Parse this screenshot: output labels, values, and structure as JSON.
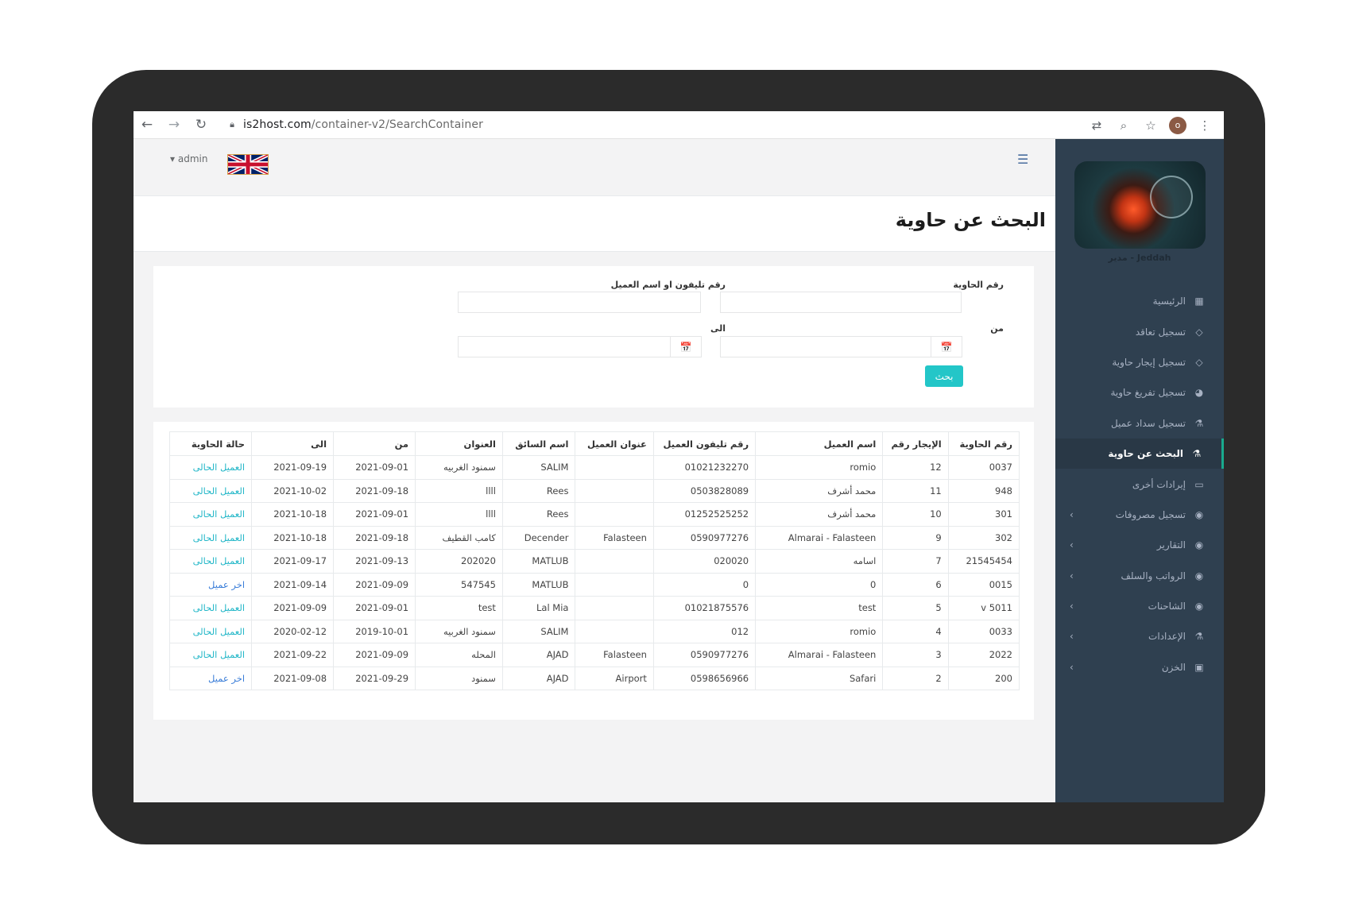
{
  "browser": {
    "url_host": "is2host.com",
    "url_path": "/container-v2/SearchContainer",
    "profile_initial": "o"
  },
  "topbar": {
    "user": "admin"
  },
  "sidebar": {
    "profile_name": "Jeddah - مدير",
    "items": [
      {
        "label": "الرئيسية",
        "icon": "dashboard-icon",
        "glyph": "▦"
      },
      {
        "label": "تسجيل تعاقد",
        "icon": "diamond-icon",
        "glyph": "◇"
      },
      {
        "label": "تسجيل إيجار حاوية",
        "icon": "diamond-icon",
        "glyph": "◇"
      },
      {
        "label": "تسجيل تفريغ حاوية",
        "icon": "pie-chart-icon",
        "glyph": "◕"
      },
      {
        "label": "تسجيل سداد عميل",
        "icon": "flask-icon",
        "glyph": "⚗"
      },
      {
        "label": "البحث عن حاوية",
        "icon": "flask-icon",
        "glyph": "⚗"
      },
      {
        "label": "إيرادات أخرى",
        "icon": "monitor-icon",
        "glyph": "▭"
      },
      {
        "label": "تسجيل مصروفات",
        "icon": "globe-icon",
        "glyph": "◉"
      },
      {
        "label": "التقارير",
        "icon": "globe-icon",
        "glyph": "◉"
      },
      {
        "label": "الرواتب والسلف",
        "icon": "globe-icon",
        "glyph": "◉"
      },
      {
        "label": "الشاحنات",
        "icon": "globe-icon",
        "glyph": "◉"
      },
      {
        "label": "الإعدادات",
        "icon": "flask-icon",
        "glyph": "⚗"
      },
      {
        "label": "الخزن",
        "icon": "money-icon",
        "glyph": "▣"
      }
    ],
    "chevron_glyph": "‹"
  },
  "page": {
    "title": "البحث عن حاوية"
  },
  "form": {
    "container_no_label": "رقم الحاوية",
    "phone_or_name_label": "رقم تليفون او اسم العميل",
    "from_label": "من",
    "to_label": "الى",
    "search_button": "بحث",
    "calendar_glyph": "📅"
  },
  "table": {
    "headers": [
      "رقم الحاوية",
      "الإيجار رقم",
      "اسم العميل",
      "رقم تليفون العميل",
      "عنوان العميل",
      "اسم السائق",
      "العنوان",
      "من",
      "الى",
      "حالة الحاوية"
    ],
    "rows": [
      [
        "0037",
        "12",
        "romio",
        "01021232270",
        "",
        "SALIM",
        "سمنود الغربيه",
        "2021-09-01",
        "2021-09-19",
        "العميل الحالى"
      ],
      [
        "948",
        "11",
        "محمد أشرف",
        "0503828089",
        "",
        "Rees",
        "llll",
        "2021-09-18",
        "2021-10-02",
        "العميل الحالى"
      ],
      [
        "301",
        "10",
        "محمد أشرف",
        "01252525252",
        "",
        "Rees",
        "llll",
        "2021-09-01",
        "2021-10-18",
        "العميل الحالى"
      ],
      [
        "302",
        "9",
        "Almarai - Falasteen",
        "0590977276",
        "Falasteen",
        "Decender",
        "كامب القطيف",
        "2021-09-18",
        "2021-10-18",
        "العميل الحالى"
      ],
      [
        "21545454",
        "7",
        "اسامه",
        "020020",
        "",
        "MATLUB",
        "202020",
        "2021-09-13",
        "2021-09-17",
        "العميل الحالى"
      ],
      [
        "0015",
        "6",
        "0",
        "0",
        "",
        "MATLUB",
        "547545",
        "2021-09-09",
        "2021-09-14",
        "اخر عميل"
      ],
      [
        "v 5011",
        "5",
        "test",
        "01021875576",
        "",
        "Lal Mia",
        "test",
        "2021-09-01",
        "2021-09-09",
        "العميل الحالى"
      ],
      [
        "0033",
        "4",
        "romio",
        "012",
        "",
        "SALIM",
        "سمنود الغربيه",
        "2019-10-01",
        "2020-02-12",
        "العميل الحالى"
      ],
      [
        "2022",
        "3",
        "Almarai - Falasteen",
        "0590977276",
        "Falasteen",
        "AJAD",
        "المحله",
        "2021-09-09",
        "2021-09-22",
        "العميل الحالى"
      ],
      [
        "200",
        "2",
        "Safari",
        "0598656966",
        "Airport",
        "AJAD",
        "سمنود",
        "2021-09-29",
        "2021-09-08",
        "اخر عميل"
      ]
    ]
  }
}
